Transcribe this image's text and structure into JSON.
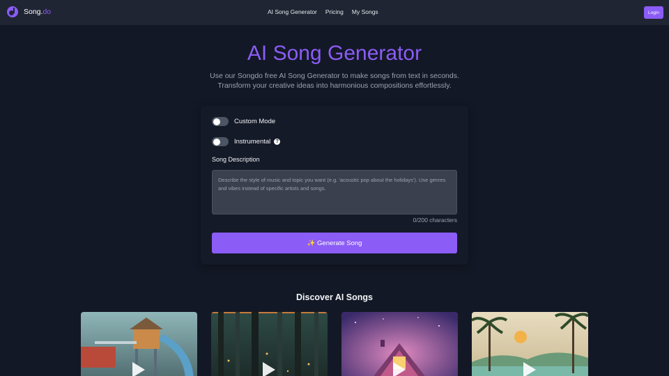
{
  "header": {
    "logo_text": "Song.",
    "logo_accent": "do",
    "nav": [
      "AI Song Generator",
      "Pricing",
      "My Songs"
    ],
    "login_label": "Login"
  },
  "hero": {
    "title": "AI Song Generator",
    "subtitle": "Use our Songdo free AI Song Generator to make songs from text in seconds. Transform your creative ideas into harmonious compositions effortlessly."
  },
  "form": {
    "custom_mode_label": "Custom Mode",
    "custom_mode_on": false,
    "instrumental_label": "Instrumental",
    "instrumental_on": false,
    "help_glyph": "?",
    "description_label": "Song Description",
    "description_value": "",
    "description_placeholder": "Describe the style of music and topic you want (e.g. 'acoustic pop about the holidays'). Use genres and vibes instead of specific artists and songs.",
    "char_count": "0/200 characters",
    "generate_label": "✨ Generate Song"
  },
  "discover": {
    "title": "Discover AI Songs",
    "songs": [
      {
        "image": "playground-tower-illustration",
        "icon": "play-icon"
      },
      {
        "image": "misty-forest-illustration",
        "icon": "play-icon"
      },
      {
        "image": "cosmic-cabin-illustration",
        "icon": "play-icon"
      },
      {
        "image": "tropical-sunset-illustration",
        "icon": "play-icon"
      }
    ]
  },
  "colors": {
    "accent": "#8b5cf6",
    "background": "#131826",
    "header": "#1f2533"
  }
}
